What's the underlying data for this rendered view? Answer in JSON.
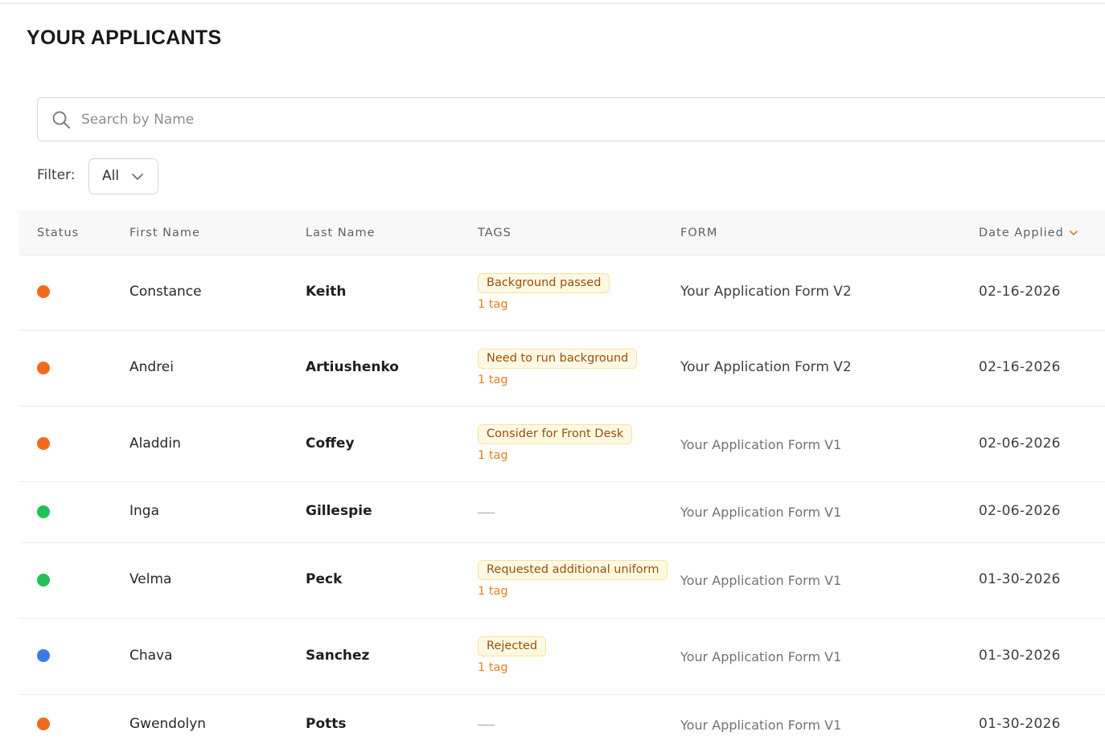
{
  "page": {
    "title": "YOUR APPLICANTS"
  },
  "search": {
    "placeholder": "Search by Name",
    "value": ""
  },
  "filter": {
    "label": "Filter:",
    "selected": "All"
  },
  "columns": {
    "status": "Status",
    "first_name": "First Name",
    "last_name": "Last Name",
    "tags": "TAGS",
    "form": "FORM",
    "date_applied": "Date Applied"
  },
  "status_colors": {
    "orange": "#f06c1c",
    "green": "#22c05a",
    "blue": "#3b7ae8"
  },
  "applicants": [
    {
      "status": "orange",
      "first_name": "Constance",
      "last_name": "Keith",
      "tag": "Background passed",
      "tag_count": "1 tag",
      "form": "Your Application Form V2",
      "date": "02-16-2026"
    },
    {
      "status": "orange",
      "first_name": "Andrei",
      "last_name": "Artiushenko",
      "tag": "Need to run background",
      "tag_count": "1 tag",
      "form": "Your Application Form V2",
      "date": "02-16-2026"
    },
    {
      "status": "orange",
      "first_name": "Aladdin",
      "last_name": "Coffey",
      "tag": "Consider for Front Desk",
      "tag_count": "1 tag",
      "form": "Your Application Form V1",
      "date": "02-06-2026"
    },
    {
      "status": "green",
      "first_name": "Inga",
      "last_name": "Gillespie",
      "tag": null,
      "tag_count": null,
      "form": "Your Application Form V1",
      "date": "02-06-2026"
    },
    {
      "status": "green",
      "first_name": "Velma",
      "last_name": "Peck",
      "tag": "Requested additional uniform",
      "tag_count": "1 tag",
      "form": "Your Application Form V1",
      "date": "01-30-2026"
    },
    {
      "status": "blue",
      "first_name": "Chava",
      "last_name": "Sanchez",
      "tag": "Rejected",
      "tag_count": "1 tag",
      "form": "Your Application Form V1",
      "date": "01-30-2026"
    },
    {
      "status": "orange",
      "first_name": "Gwendolyn",
      "last_name": "Potts",
      "tag": null,
      "tag_count": null,
      "form": "Your Application Form V1",
      "date": "01-30-2026"
    }
  ]
}
